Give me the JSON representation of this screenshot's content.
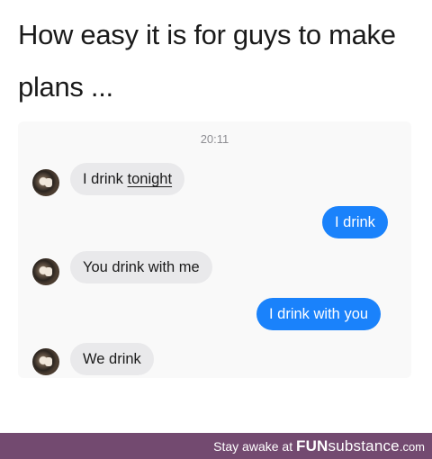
{
  "caption": {
    "line1": "How easy it is for guys to make",
    "line2": "plans ..."
  },
  "chat": {
    "timestamp": "20:11",
    "messages": [
      {
        "side": "incoming",
        "text_plain": "I drink ",
        "text_underlined": "tonight"
      },
      {
        "side": "outgoing",
        "text": "I drink"
      },
      {
        "side": "incoming",
        "text": "You drink with me"
      },
      {
        "side": "outgoing",
        "text": "I drink with you"
      },
      {
        "side": "incoming",
        "text": "We drink"
      }
    ],
    "colors": {
      "incoming_bubble": "#e9e9eb",
      "outgoing_bubble": "#1a82fb"
    }
  },
  "footer": {
    "prefix": "Stay awake at ",
    "brand_part1": "FUN",
    "brand_part2": "substance",
    "brand_suffix": ".com",
    "background": "#734a70"
  }
}
